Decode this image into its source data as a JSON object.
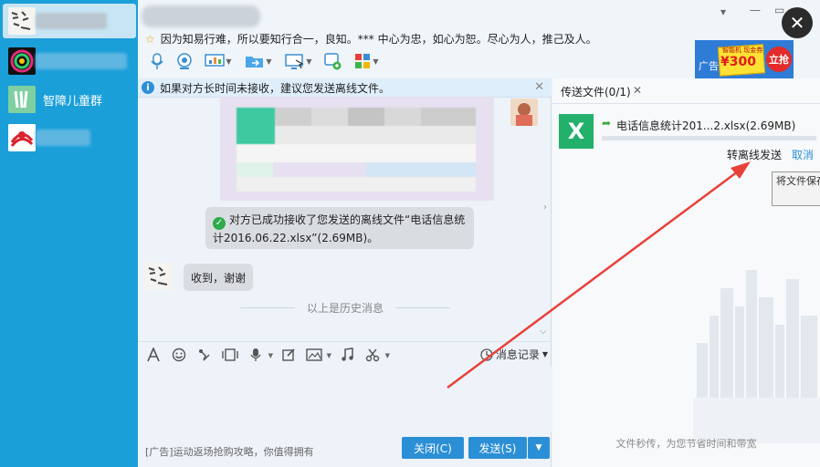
{
  "sidebar": {
    "contacts": [
      {
        "label": ""
      },
      {
        "label": ""
      },
      {
        "label": "智障儿童群"
      },
      {
        "label": ""
      }
    ]
  },
  "header": {
    "signature": "因为知易行难，所以要知行合一，良知。*** 中心为忠，如心为恕。尽心为人，推己及人。",
    "icons": [
      "microphone-icon",
      "video-call-icon",
      "screen-share-icon",
      "send-file-icon",
      "remote-desktop-icon",
      "invite-icon",
      "apps-grid-icon"
    ],
    "ad": {
      "label": "广告",
      "price": "¥300",
      "top_text": "智能机 现金券",
      "button": "立抢"
    },
    "close_symbol": "✕",
    "minimize_symbol": "▾",
    "maximize_symbol": "▭"
  },
  "chat": {
    "notice": "如果对方长时间未接收，建议您发送离线文件。",
    "system_message": "对方已成功接收了您发送的离线文件“电话信息统计2016.06.22.xlsx”(2.69MB)。",
    "message": "收到，谢谢",
    "history_separator": "以上是历史消息",
    "input_icons": [
      "font-icon",
      "emoji-icon",
      "nudge-icon",
      "gif-icon",
      "voice-message-icon",
      "edit-icon",
      "image-icon",
      "music-icon",
      "scissors-icon"
    ],
    "message_record_label": "消息记录",
    "ad_text": "[广告]运动返场抢购攻略，你值得拥有",
    "close_button": "关闭(C)",
    "send_button": "发送(S)"
  },
  "transfer": {
    "tab_label": "传送文件(0/1)",
    "file_name": "电话信息统计201...2.xlsx(2.69MB)",
    "progress_percent": 0,
    "offline_label": "转离线发送",
    "cancel_label": "取消",
    "tooltip": "将文件保存到服务器，提醒进行接收",
    "footer": "文件秒传，为您节省时间和带宽"
  },
  "colors": {
    "sidebar": "#1b9fd9",
    "accent": "#2b8fd6",
    "arrow": "#e8413a",
    "excel": "#22b06a"
  }
}
